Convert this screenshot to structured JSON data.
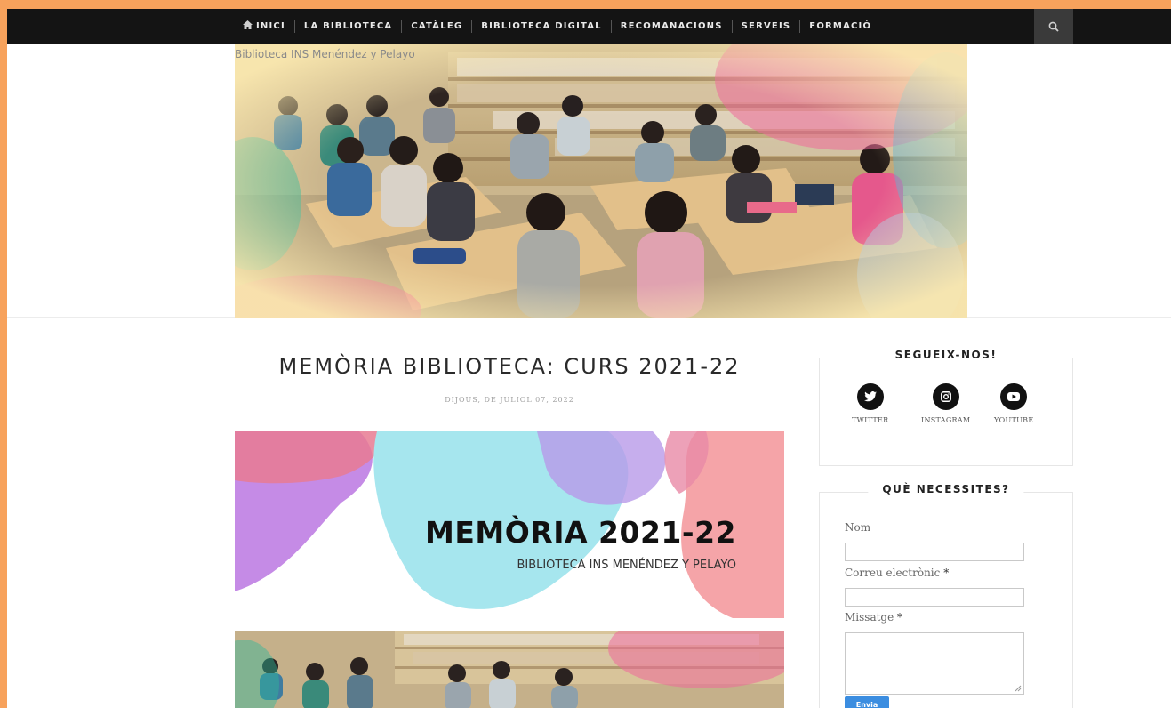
{
  "nav": {
    "items": [
      {
        "label": "INICI"
      },
      {
        "label": "LA BIBLIOTECA"
      },
      {
        "label": "CATÀLEG"
      },
      {
        "label": "BIBLIOTECA DIGITAL"
      },
      {
        "label": "RECOMANACIONS"
      },
      {
        "label": "SERVEIS"
      },
      {
        "label": "FORMACIÓ"
      }
    ],
    "search_icon": "search-icon",
    "home_icon": "home-icon"
  },
  "header": {
    "site_title": "Biblioteca INS Menéndez y Pelayo"
  },
  "post": {
    "title": "MEMÒRIA BIBLIOTECA: CURS 2021-22",
    "date": "DIJOUS, DE JULIOL 07, 2022",
    "card_title": "MEMÒRIA 2021-22",
    "card_subtitle": "BIBLIOTECA INS MENÉNDEZ Y PELAYO"
  },
  "sidebar": {
    "follow": {
      "title": "SEGUEIX-NOS!",
      "links": [
        {
          "label": "TWITTER",
          "icon": "twitter-icon"
        },
        {
          "label": "INSTAGRAM",
          "icon": "instagram-icon"
        },
        {
          "label": "YOUTUBE",
          "icon": "youtube-icon"
        }
      ]
    },
    "contact": {
      "title": "QUÈ NECESSITES?",
      "name_label": "Nom",
      "email_label": "Correu electrònic",
      "message_label": "Missatge",
      "required_mark": "*",
      "send_label": "Envia"
    }
  },
  "colors": {
    "page_border": "#f7a25c",
    "nav_bg": "#141414",
    "send_button": "#3b8de0"
  }
}
